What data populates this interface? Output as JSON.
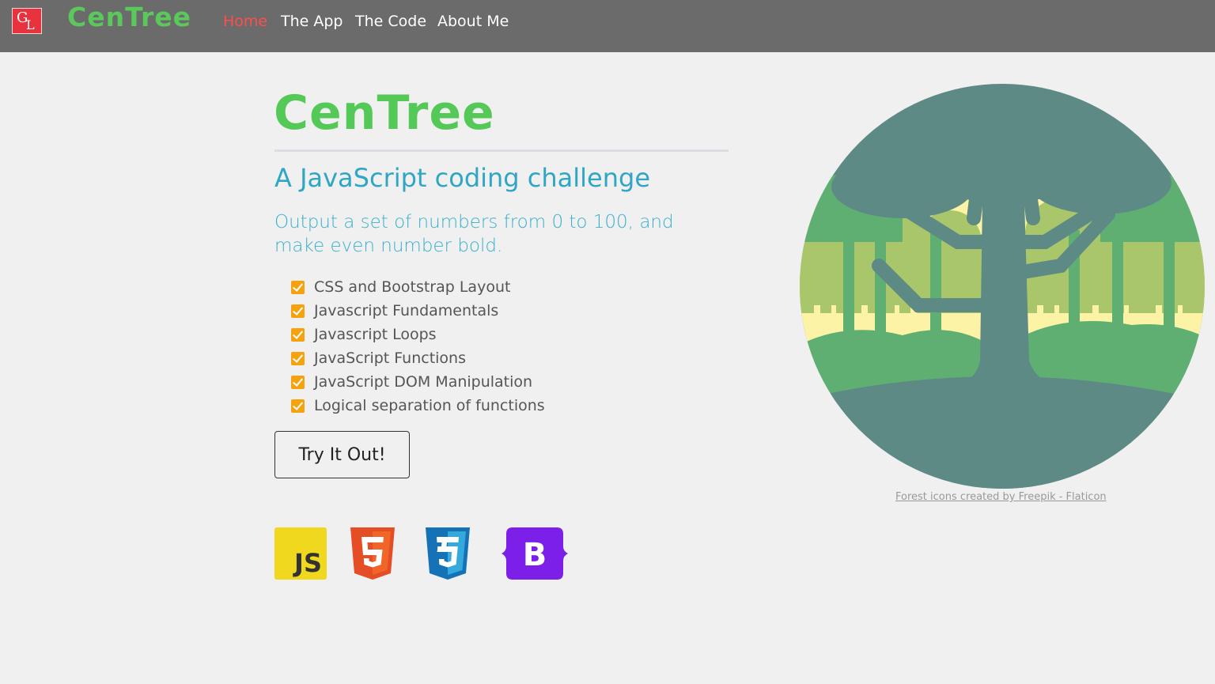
{
  "navbar": {
    "logo_letters": [
      "G",
      "L"
    ],
    "brand": "CenTree",
    "links": [
      "Home",
      "The App",
      "The Code",
      "About Me"
    ],
    "active_link": "Home"
  },
  "main": {
    "title": "CenTree",
    "subtitle": "A JavaScript coding challenge",
    "lead": "Output a set of numbers from 0 to 100, and make even number bold.",
    "features": [
      "CSS and Bootstrap Layout",
      "Javascript Fundamentals",
      "Javascript Loops",
      "JavaScript Functions",
      "JavaScript DOM Manipulation",
      "Logical separation of functions"
    ],
    "button_label": "Try It Out!",
    "tech_icons": [
      {
        "name": "javascript-icon",
        "label": "JS",
        "color": "#efd81d"
      },
      {
        "name": "html5-icon",
        "label": "5",
        "color": "#e44d26"
      },
      {
        "name": "css3-icon",
        "label": "3",
        "color": "#1572b6"
      },
      {
        "name": "bootstrap-icon",
        "label": "B",
        "color": "#7c1fe8"
      }
    ]
  },
  "hero": {
    "image_name": "forest-tree-illustration",
    "credit": "Forest icons created by Freepik - Flaticon"
  },
  "colors": {
    "navbar_bg": "#6b6b6b",
    "brand_green": "#55c957",
    "heading_blue": "#2fa6c4",
    "check_orange": "#f5a20e",
    "active_link": "#ff4d4d"
  }
}
